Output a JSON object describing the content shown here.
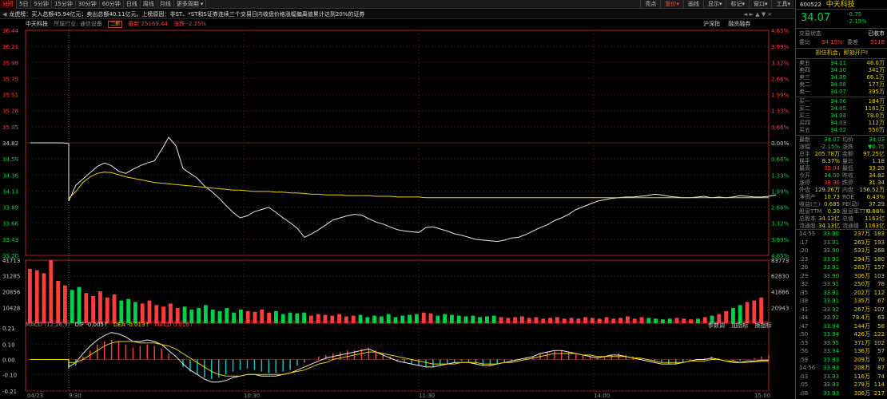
{
  "toolbar": {
    "tabs": [
      "分时",
      "5日",
      "5分钟",
      "15分钟",
      "30分钟",
      "60分钟",
      "日线",
      "周线",
      "月线",
      "更多周期"
    ],
    "active": 0,
    "right": [
      "亮点",
      "复价",
      "画线",
      "显示",
      "标记",
      "窗口",
      "工具"
    ]
  },
  "marquee": {
    "text": "龙虎榜：买入总额45.94亿元；卖出总额40.11亿元。上榜原因：非ST、*ST和S证券连续三个交易日内收盘价格涨幅偏离值累计达到20%的证券",
    "controls": "◄ ► ▲ ▼ ×"
  },
  "info": {
    "name": "中天科技",
    "industry": "所属行业: 通信设备",
    "indicator_tag": "二郎",
    "latest": "最新 25169.44",
    "change": "涨跌 -2.25%",
    "btn_index": "沪深指",
    "btn_margin": "融资融券"
  },
  "chart_data": [
    {
      "type": "line",
      "title": "",
      "series": [
        {
          "name": "",
          "values": [
            34.82,
            34.82,
            34.82,
            34.82,
            34.82,
            34.82,
            34.81,
            33.98,
            34.21,
            34.3,
            34.39,
            34.48,
            34.53,
            34.49,
            34.41,
            34.38,
            34.44,
            34.49,
            34.53,
            34.56,
            34.72,
            34.9,
            34.78,
            34.45,
            34.38,
            34.31,
            34.2,
            34.12,
            34.03,
            33.92,
            33.82,
            33.74,
            33.77,
            33.83,
            33.86,
            33.89,
            33.82,
            33.74,
            33.67,
            33.59,
            33.46,
            33.51,
            33.57,
            33.64,
            33.71,
            33.74,
            33.77,
            33.79,
            33.78,
            33.73,
            33.68,
            33.65,
            33.61,
            33.57,
            33.55,
            33.54,
            33.53,
            33.6,
            33.61,
            33.58,
            33.55,
            33.51,
            33.49,
            33.46,
            33.43,
            33.42,
            33.41,
            33.4,
            33.42,
            33.45,
            33.46,
            33.5,
            33.55,
            33.6,
            33.64,
            33.7,
            33.74,
            33.79,
            33.86,
            33.9,
            33.94,
            33.98,
            34.0,
            34.02,
            34.03,
            34.04,
            34.04,
            34.05,
            34.06,
            34.08,
            34.07,
            34.05,
            34.04,
            34.03,
            34.03,
            34.04,
            34.05,
            34.03,
            34.04,
            34.03,
            34.04,
            34.06,
            34.05,
            34.04,
            34.04,
            34.05,
            34.07
          ]
        },
        {
          "name": "",
          "values": [
            null,
            null,
            null,
            null,
            null,
            null,
            null,
            34.02,
            34.12,
            34.25,
            34.33,
            34.38,
            34.4,
            34.39,
            34.36,
            34.33,
            34.31,
            34.29,
            34.27,
            34.25,
            34.24,
            34.23,
            34.22,
            34.21,
            34.2,
            34.19,
            34.18,
            34.17,
            34.16,
            34.15,
            34.14,
            34.14,
            34.13,
            34.12,
            34.12,
            34.12,
            34.11,
            34.11,
            34.1,
            34.1,
            34.09,
            34.08,
            34.08,
            34.07,
            34.07,
            34.07,
            34.06,
            34.06,
            34.06,
            34.06,
            34.05,
            34.05,
            34.05,
            34.04,
            34.04,
            34.04,
            34.04,
            34.03,
            34.03,
            34.03,
            34.03,
            34.03,
            34.03,
            34.03,
            34.03,
            34.03,
            34.03,
            34.03,
            34.03,
            34.03,
            34.03,
            34.03,
            34.03,
            34.03,
            34.03,
            34.03,
            34.03,
            34.03,
            34.03,
            34.03,
            34.03,
            34.03,
            34.03,
            34.03,
            34.03,
            34.03,
            34.03,
            34.03,
            34.03,
            34.03,
            34.03,
            34.03,
            34.03,
            34.03,
            34.03,
            34.03,
            34.03,
            34.03,
            34.03,
            34.03,
            34.03,
            34.03,
            34.03,
            34.03,
            34.03,
            34.03
          ]
        }
      ],
      "ylim": [
        33.2,
        36.44
      ],
      "yticks": [
        "36.44",
        "36.21",
        "35.98",
        "35.75",
        "35.51",
        "35.28",
        "35.05",
        "34.82",
        "34.59",
        "34.36",
        "34.13",
        "33.89",
        "33.66",
        "33.43",
        "33.20"
      ],
      "yticks_right": [
        "4.65%",
        "3.99%",
        "3.32%",
        "2.66%",
        "1.99%",
        "1.33%",
        "0.66%",
        "0.00%",
        "0.66%",
        "1.33%",
        "1.99%",
        "2.66%",
        "3.32%",
        "3.99%",
        "4.65%"
      ]
    },
    {
      "type": "bar",
      "yticks": [
        "41713",
        "31285",
        "20856",
        "10428"
      ],
      "yticks_right": [
        "83773",
        "62830",
        "41886",
        "20943"
      ],
      "values": [
        36000,
        35000,
        33000,
        41713,
        28000,
        25000,
        22000,
        24000,
        20000,
        18000,
        21000,
        17000,
        19000,
        15000,
        16000,
        14000,
        13000,
        15000,
        12000,
        11000,
        13000,
        10000,
        11000,
        9000,
        10000,
        12000,
        9000,
        8000,
        10000,
        7000,
        9000,
        8000,
        7500,
        9000,
        7000,
        8000,
        6000,
        7000,
        6500,
        7000,
        5000,
        6000,
        5500,
        5000,
        6000,
        4500,
        5000,
        5500,
        4000,
        5000,
        4500,
        6000,
        4000,
        5000,
        5500,
        6000,
        7000,
        6500,
        5000,
        6000,
        5500,
        5000,
        4500,
        5000,
        4000,
        4500,
        5000,
        4000,
        3500,
        4000,
        4500,
        3500,
        4000,
        3000,
        3500,
        4000,
        3000,
        3500,
        3000,
        4000,
        3500,
        3000,
        4000,
        3000,
        3500,
        4500,
        3000,
        4000,
        3500,
        3000,
        2500,
        3000,
        3500,
        3000,
        2500,
        3000,
        4000,
        5000,
        6000,
        8000,
        10000,
        12000,
        14000,
        15000,
        17000
      ]
    },
    {
      "type": "bar",
      "title": "MACD (12,26,9)",
      "dif": "DIF -0.005↑",
      "dea": "DEA -0.013↑",
      "macd": "MACD 0.016↑",
      "yticks": [
        "0.21",
        "0.10",
        "0.00",
        "-0.10",
        "-0.21"
      ],
      "ylim": [
        -0.21,
        0.21
      ],
      "values": [
        0.0,
        0.0,
        0.0,
        0.0,
        0.0,
        0.0,
        0.0,
        -0.06,
        -0.04,
        0.02,
        0.06,
        0.1,
        0.12,
        0.13,
        0.12,
        0.1,
        0.08,
        0.09,
        0.1,
        0.09,
        0.07,
        0.04,
        0.0,
        -0.05,
        -0.08,
        -0.1,
        -0.12,
        -0.13,
        -0.12,
        -0.1,
        -0.08,
        -0.07,
        -0.06,
        -0.07,
        -0.08,
        -0.09,
        -0.09,
        -0.08,
        -0.07,
        -0.04,
        -0.02,
        0.0,
        0.02,
        0.03,
        0.04,
        0.05,
        0.06,
        0.06,
        0.07,
        0.08,
        0.06,
        0.04,
        0.02,
        -0.01,
        -0.02,
        -0.03,
        -0.04,
        -0.05,
        -0.05,
        -0.04,
        -0.03,
        -0.02,
        -0.01,
        -0.02,
        -0.03,
        -0.04,
        -0.04,
        -0.03,
        -0.02,
        -0.01,
        0.0,
        0.01,
        0.02,
        0.04,
        0.05,
        0.06,
        0.06,
        0.05,
        0.04,
        0.03,
        0.02,
        0.01,
        0.02,
        0.03,
        0.04,
        0.03,
        0.02,
        0.01,
        0.0,
        -0.01,
        -0.02,
        -0.03,
        -0.03,
        -0.02,
        -0.01,
        0.0,
        0.01,
        0.02,
        0.01,
        0.0,
        -0.01,
        -0.01,
        0.0,
        0.01,
        0.02,
        0.03
      ],
      "dif_values": [
        0.0,
        0.0,
        0.0,
        0.0,
        0.0,
        0.0,
        0.0,
        -0.05,
        -0.02,
        0.04,
        0.09,
        0.13,
        0.16,
        0.18,
        0.17,
        0.15,
        0.12,
        0.12,
        0.13,
        0.12,
        0.1,
        0.06,
        0.02,
        -0.03,
        -0.07,
        -0.1,
        -0.13,
        -0.15,
        -0.15,
        -0.14,
        -0.12,
        -0.11,
        -0.1,
        -0.1,
        -0.11,
        -0.11,
        -0.11,
        -0.1,
        -0.09,
        -0.07,
        -0.05,
        -0.03,
        -0.01,
        0.01,
        0.02,
        0.03,
        0.04,
        0.05,
        0.06,
        0.07,
        0.05,
        0.03,
        0.01,
        -0.01,
        -0.02,
        -0.03,
        -0.04,
        -0.05,
        -0.05,
        -0.04,
        -0.03,
        -0.02,
        -0.02,
        -0.02,
        -0.03,
        -0.04,
        -0.04,
        -0.03,
        -0.02,
        -0.01,
        0.0,
        0.01,
        0.02,
        0.04,
        0.05,
        0.06,
        0.06,
        0.05,
        0.04,
        0.03,
        0.02,
        0.01,
        0.02,
        0.03,
        0.03,
        0.02,
        0.01,
        0.0,
        -0.01,
        -0.02,
        -0.03,
        -0.03,
        -0.03,
        -0.02,
        -0.01,
        0.0,
        0.0,
        0.01,
        0.0,
        -0.01,
        -0.02,
        -0.02,
        -0.01,
        -0.01,
        -0.005,
        -0.005
      ],
      "dea_values": [
        0.0,
        0.0,
        0.0,
        0.0,
        0.0,
        0.0,
        0.0,
        -0.02,
        -0.02,
        0.0,
        0.03,
        0.06,
        0.09,
        0.11,
        0.12,
        0.12,
        0.12,
        0.11,
        0.11,
        0.11,
        0.1,
        0.09,
        0.07,
        0.04,
        0.01,
        -0.02,
        -0.05,
        -0.08,
        -0.1,
        -0.11,
        -0.11,
        -0.11,
        -0.1,
        -0.1,
        -0.1,
        -0.1,
        -0.1,
        -0.1,
        -0.09,
        -0.08,
        -0.07,
        -0.05,
        -0.03,
        -0.02,
        0.0,
        0.01,
        0.02,
        0.03,
        0.04,
        0.05,
        0.05,
        0.04,
        0.03,
        0.02,
        0.01,
        0.0,
        -0.01,
        -0.02,
        -0.03,
        -0.03,
        -0.03,
        -0.03,
        -0.02,
        -0.02,
        -0.02,
        -0.03,
        -0.03,
        -0.03,
        -0.02,
        -0.02,
        -0.01,
        0.0,
        0.01,
        0.02,
        0.03,
        0.04,
        0.04,
        0.04,
        0.04,
        0.03,
        0.03,
        0.02,
        0.02,
        0.02,
        0.02,
        0.02,
        0.01,
        0.01,
        0.0,
        -0.01,
        -0.02,
        -0.02,
        -0.02,
        -0.02,
        -0.01,
        -0.01,
        -0.01,
        0.0,
        0.0,
        -0.01,
        -0.01,
        -0.02,
        -0.02,
        -0.015,
        -0.013,
        -0.013
      ]
    }
  ],
  "xaxis": [
    "04/23",
    "9:30",
    "10:30",
    "11:30",
    "14:00",
    "15:00"
  ],
  "macd_btns": [
    "参数调",
    "加指标",
    "换指标"
  ],
  "panel": {
    "code": "600522",
    "name": "中天科技",
    "price": "34.07",
    "chg": "-0.75",
    "pct": "-2.15%",
    "status_label": "交易状态",
    "status": "已收市",
    "wb_label": "委比",
    "wb": "34.15%",
    "wc_label": "委差",
    "wc": "3118",
    "promo": "抓住机会，即刻开户!",
    "sells": [
      [
        "卖五",
        "34.11",
        "46.0万"
      ],
      [
        "卖四",
        "34.10",
        "341万"
      ],
      [
        "卖三",
        "34.09",
        "66.1万"
      ],
      [
        "卖二",
        "34.08",
        "177万"
      ],
      [
        "卖一",
        "34.07",
        "395万"
      ]
    ],
    "buys": [
      [
        "买一",
        "34.06",
        "184万"
      ],
      [
        "买二",
        "34.05",
        "1161万"
      ],
      [
        "买三",
        "34.04",
        "78.0万"
      ],
      [
        "买四",
        "34.03",
        "112万"
      ],
      [
        "买五",
        "34.02",
        "550万"
      ]
    ],
    "stats": [
      [
        "最新",
        "34.07",
        "均价",
        "34.03"
      ],
      [
        "涨幅",
        "-2.15%",
        "涨跌",
        "▼0.75"
      ],
      [
        "总手",
        "205.78万",
        "金额",
        "97.25亿"
      ],
      [
        "换手",
        "8.37%",
        "量比",
        "1.18"
      ],
      [
        "最高",
        "35.04",
        "最低",
        "33.20"
      ],
      [
        "今开",
        "34.00",
        "昨收",
        "34.82"
      ],
      [
        "涨停",
        "38.30",
        "跌停",
        "31.34"
      ],
      [
        "外盘",
        "129.26万",
        "内盘",
        "156.52万"
      ],
      [
        "净资产",
        "10.73",
        "ROE",
        "6.43%"
      ],
      [
        "收益(三)",
        "0.685",
        "PE(动)",
        "37.29"
      ],
      [
        "股息TTM",
        "0.30",
        "股息率TTM",
        "0.88%"
      ],
      [
        "总股本",
        "34.13亿",
        "总值",
        "1163亿"
      ],
      [
        "流通股",
        "34.13亿",
        "流通值",
        "1163亿"
      ]
    ],
    "ticks": [
      [
        "14:55",
        "33.90",
        "237万",
        "183"
      ],
      [
        ":17",
        "33.91",
        "263万",
        "193"
      ],
      [
        ":20",
        "33.90",
        "533万",
        "268"
      ],
      [
        ":23",
        "33.91",
        "294万",
        "180"
      ],
      [
        ":26",
        "33.91",
        "263万",
        "157"
      ],
      [
        ":29",
        "33.90",
        "306万",
        "103"
      ],
      [
        ":32",
        "33.91",
        "250万",
        "78"
      ],
      [
        ":35",
        "33.91",
        "202万",
        "112"
      ],
      [
        ":38",
        "33.91",
        "135万",
        "67"
      ],
      [
        ":41",
        "33.92",
        "267万",
        "107"
      ],
      [
        ":44",
        "33.92",
        "78.4万",
        "63"
      ],
      [
        ":47",
        "33.94",
        "144万",
        "58"
      ],
      [
        ":50",
        "33.94",
        "426万",
        "122"
      ],
      [
        ":53",
        "33.95",
        "371万",
        "102"
      ],
      [
        ":56",
        "33.94",
        "136万",
        "57"
      ],
      [
        ":59",
        "33.93",
        "209万",
        "70"
      ],
      [
        "14:56",
        "33.93",
        "208万",
        "87"
      ],
      [
        ":03",
        "33.93",
        "116万",
        "74"
      ],
      [
        ":05",
        "33.93",
        "279万",
        "114"
      ],
      [
        ":08",
        "33.93",
        "306万",
        "217"
      ]
    ]
  }
}
